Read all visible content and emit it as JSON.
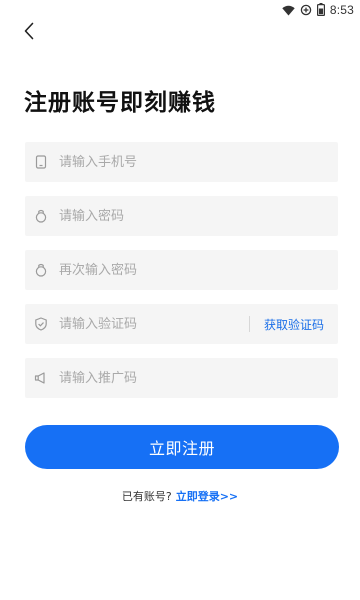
{
  "status_bar": {
    "time": "8:53",
    "icons": [
      "wifi-icon",
      "battery-saver-icon",
      "battery-icon"
    ]
  },
  "nav": {
    "back_icon": "chevron-left-icon"
  },
  "page": {
    "title": "注册账号即刻赚钱"
  },
  "form": {
    "phone": {
      "icon": "phone-icon",
      "placeholder": "请输入手机号",
      "value": ""
    },
    "password": {
      "icon": "lock-icon",
      "placeholder": "请输入密码",
      "value": ""
    },
    "password_confirm": {
      "icon": "lock-icon",
      "placeholder": "再次输入密码",
      "value": ""
    },
    "verification_code": {
      "icon": "shield-check-icon",
      "placeholder": "请输入验证码",
      "value": "",
      "get_code_label": "获取验证码"
    },
    "referral_code": {
      "icon": "megaphone-icon",
      "placeholder": "请输入推广码",
      "value": ""
    }
  },
  "actions": {
    "register_label": "立即注册"
  },
  "footer": {
    "prompt": "已有账号?",
    "login_link": "立即登录>>"
  },
  "colors": {
    "accent": "#1670f5",
    "field_bg": "#f5f5f5",
    "placeholder": "#a9a9a9",
    "title": "#111111"
  }
}
